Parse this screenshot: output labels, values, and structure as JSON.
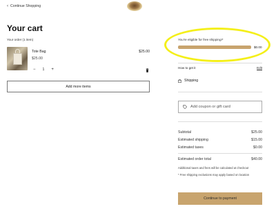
{
  "header": {
    "continue_label": "Continue Shopping",
    "logo_icon": "brand-logo"
  },
  "cart": {
    "title": "Your cart",
    "order_count": "Your order (1 item)",
    "items": [
      {
        "name": "Tote Bag",
        "unit_price": "$25.00",
        "line_total": "$25.00",
        "quantity": "1",
        "decrement": "−",
        "increment": "+"
      }
    ],
    "add_more_label": "Add more items"
  },
  "shipping_progress": {
    "message": "You're eligible for free shipping!*",
    "remaining": "$0.00",
    "progress_fraction": 1.0,
    "bar_color": "#c8a46e",
    "track_color": "#e6dcc5"
  },
  "annotation": {
    "highlight_color": "#f4ef1a"
  },
  "fulfillment": {
    "how_label": "How to get it",
    "edit_label": "Edit",
    "method": "Shipping",
    "method_icon": "box-icon"
  },
  "coupon": {
    "placeholder": "Add coupon or gift card",
    "icon": "tag-icon"
  },
  "summary": {
    "subtotal_label": "Subtotal",
    "subtotal_value": "$25.00",
    "shipping_label": "Estimated shipping",
    "shipping_value": "$15.00",
    "taxes_label": "Estimated taxes",
    "taxes_value": "$0.00",
    "total_label": "Estimated order total",
    "total_value": "$40.00",
    "note_taxes": "Additional taxes and fees will be calculated at checkout",
    "note_shipping": "* Free shipping exclusions may apply based on location"
  },
  "checkout": {
    "pay_label": "Continue to payment",
    "button_color": "#c8a46e"
  }
}
